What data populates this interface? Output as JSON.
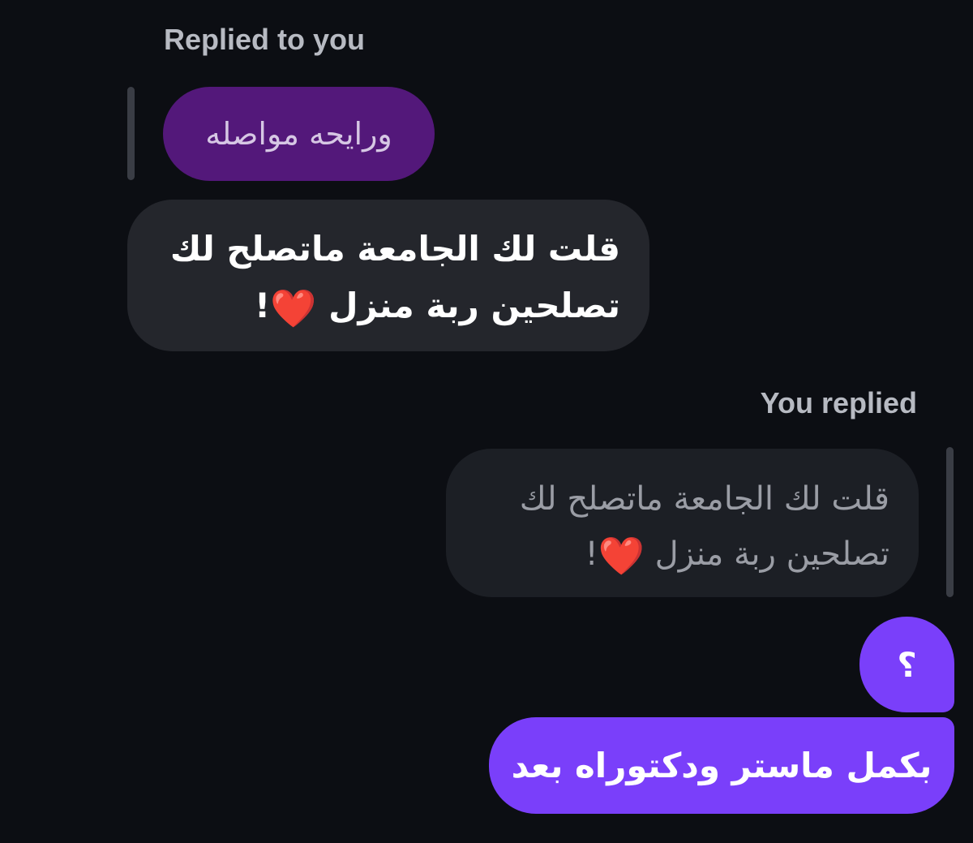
{
  "thread": {
    "incoming_header": "Replied to you",
    "outgoing_header": "You replied",
    "incoming_quote_text": "ورايحه مواصله",
    "incoming_message": {
      "line1": "قلت لك الجامعة ماتصلح لك",
      "line2": "تصلحين ربة منزل",
      "heart": "❤️",
      "punct": "!"
    },
    "outgoing_quote": {
      "line1": "قلت لك الجامعة ماتصلح لك",
      "line2": "تصلحين ربة منزل",
      "heart": "❤️",
      "punct": "!"
    },
    "outgoing_question": "؟",
    "outgoing_reply": "بكمل ماستر ودكتوراه بعد"
  },
  "colors": {
    "background": "#0c0e13",
    "incoming_bubble": "#24262c",
    "quoted_purple_bubble": "#53187a",
    "outgoing_bubble": "#7a3ffa",
    "label_text": "#b7bac2"
  }
}
